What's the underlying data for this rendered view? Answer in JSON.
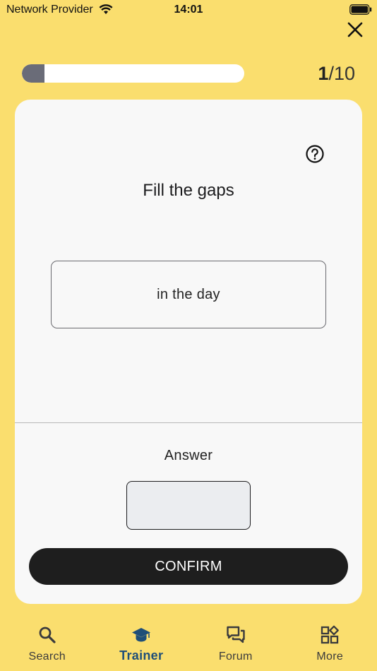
{
  "status_bar": {
    "carrier": "Network Provider",
    "time": "14:01"
  },
  "progress": {
    "current": "1",
    "total": "/10",
    "fraction": 0.1
  },
  "card": {
    "title": "Fill the gaps",
    "prompt": "in the day",
    "answer_label": "Answer",
    "answer_value": "",
    "confirm_label": "CONFIRM"
  },
  "tabs": [
    {
      "label": "Search",
      "icon": "search-icon",
      "active": false
    },
    {
      "label": "Trainer",
      "icon": "graduation-cap-icon",
      "active": true
    },
    {
      "label": "Forum",
      "icon": "chat-bubbles-icon",
      "active": false
    },
    {
      "label": "More",
      "icon": "grid-icon",
      "active": false
    }
  ],
  "colors": {
    "background": "#fade6e",
    "card": "#f8f8f8",
    "progress_fill": "#6a6c78",
    "button": "#1e1e1e",
    "active_tab": "#1f4f78"
  }
}
